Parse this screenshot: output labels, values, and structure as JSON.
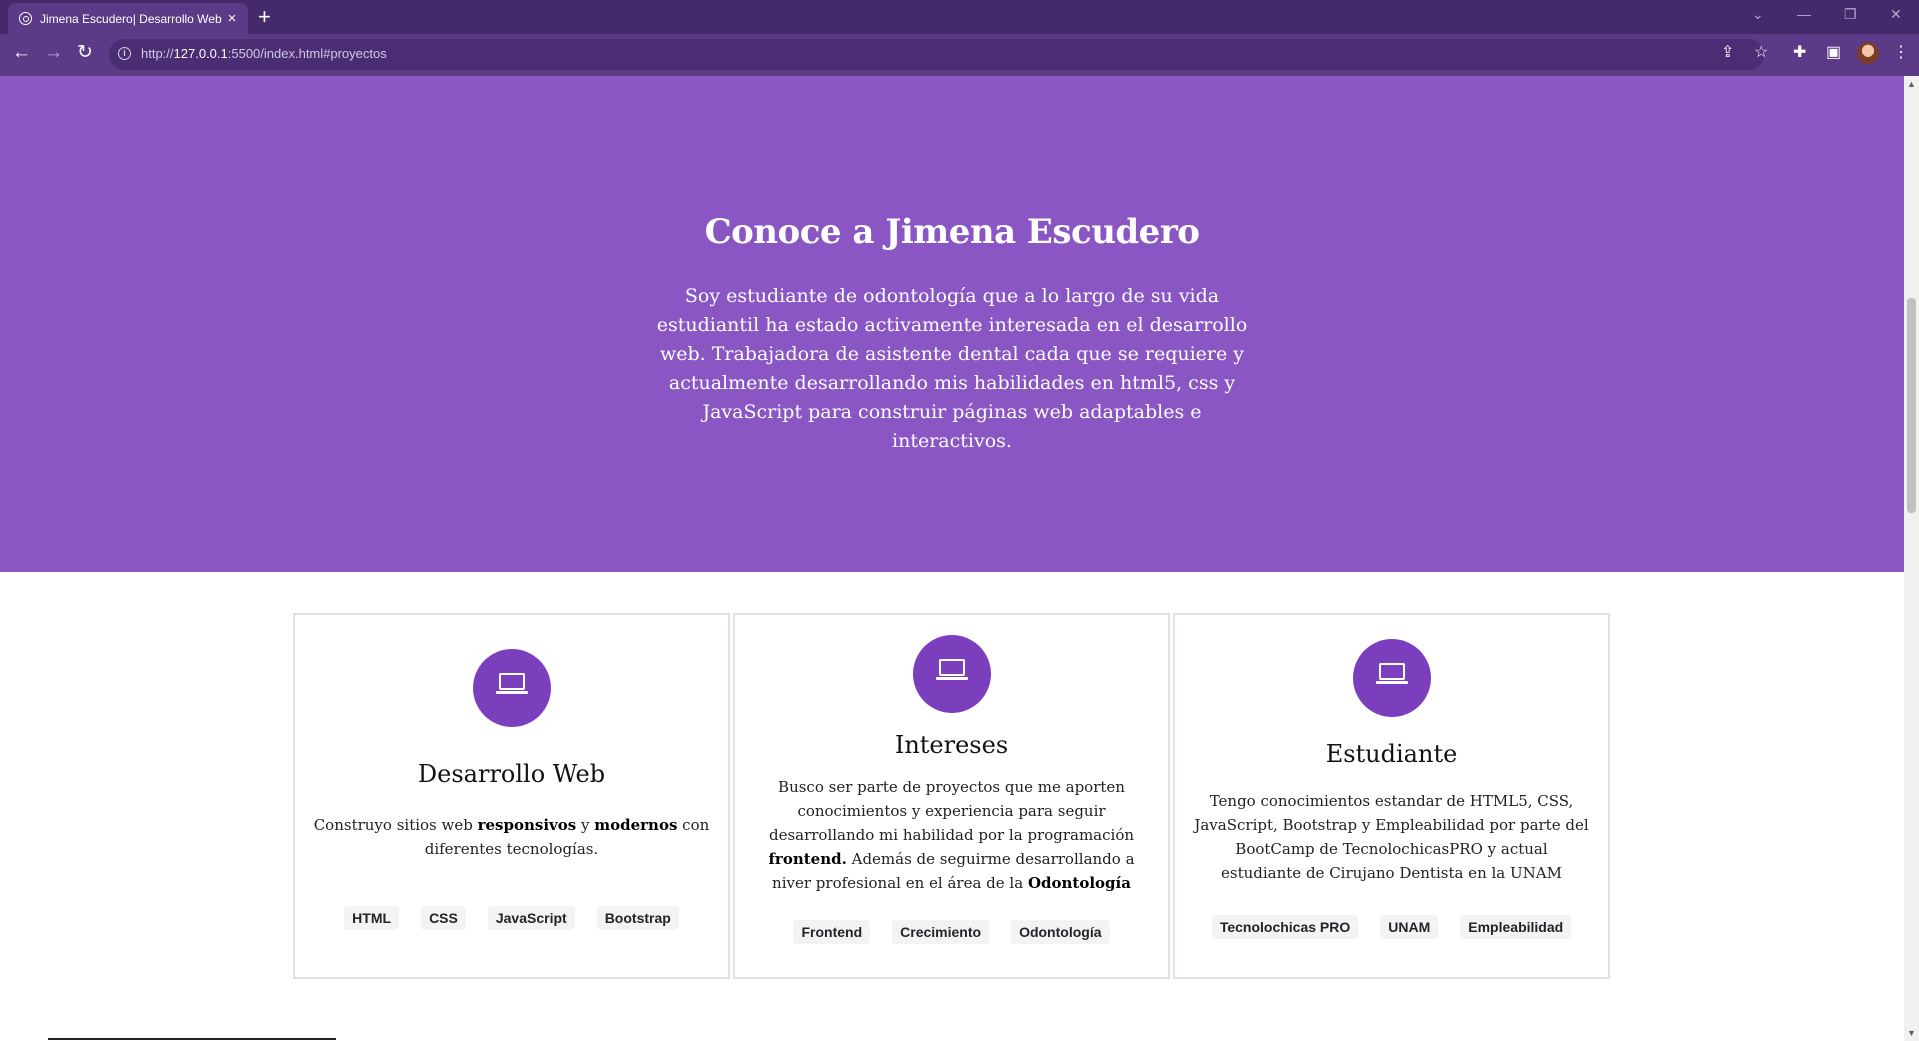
{
  "browser": {
    "tab_title": "Jimena Escudero| Desarrollo Web",
    "tab_close": "×",
    "new_tab": "+",
    "url_prefix": "http://",
    "url_host": "127.0.0.1",
    "url_rest": ":5500/index.html#proyectos",
    "info_glyph": "i",
    "back": "←",
    "forward": "→",
    "reload": "↻",
    "icons": [
      "share-icon",
      "star-icon",
      "extensions-icon",
      "sidepanel-icon",
      "profile-avatar",
      "menu-icon"
    ],
    "colors": {
      "tabbar": "#452a6b",
      "toolbar": "#5b3a87"
    }
  },
  "hero": {
    "title": "Conoce a Jimena Escudero",
    "paragraph": "Soy estudiante de odontología que a lo largo de su vida estudiantil ha estado activamente interesada en el desarrollo web. Trabajadora de asistente dental cada que se requiere y actualmente desarrollando mis habilidades en html5, css y JavaScript para construir páginas web adaptables e interactivos.",
    "color": "#8a56c4"
  },
  "cards": [
    {
      "title": "Desarrollo Web",
      "desc": [
        "Construyo sitios web ",
        "responsivos",
        " y ",
        "modernos",
        " con diferentes tecnologías."
      ],
      "tags": [
        "HTML",
        "CSS",
        "JavaScript",
        "Bootstrap"
      ]
    },
    {
      "title": "Intereses",
      "desc": [
        "Busco ser parte de proyectos que me aporten conocimientos y experiencia para seguir desarrollando mi habilidad por la programación ",
        "frontend.",
        " Además de seguirme desarrollando a niver profesional en el área de la ",
        "Odontología"
      ],
      "tags": [
        "Frontend",
        "Crecimiento",
        "Odontología"
      ]
    },
    {
      "title": "Estudiante",
      "desc": [
        "Tengo conocimientos estandar de HTML5, CSS, JavaScript, Bootstrap y Empleabilidad por parte del BootCamp de TecnolochicasPRO y actual estudiante de Cirujano Dentista en la UNAM"
      ],
      "tags": [
        "Tecnolochicas PRO",
        "UNAM",
        "Empleabilidad"
      ]
    }
  ],
  "accent_color": "#7b3fbe"
}
